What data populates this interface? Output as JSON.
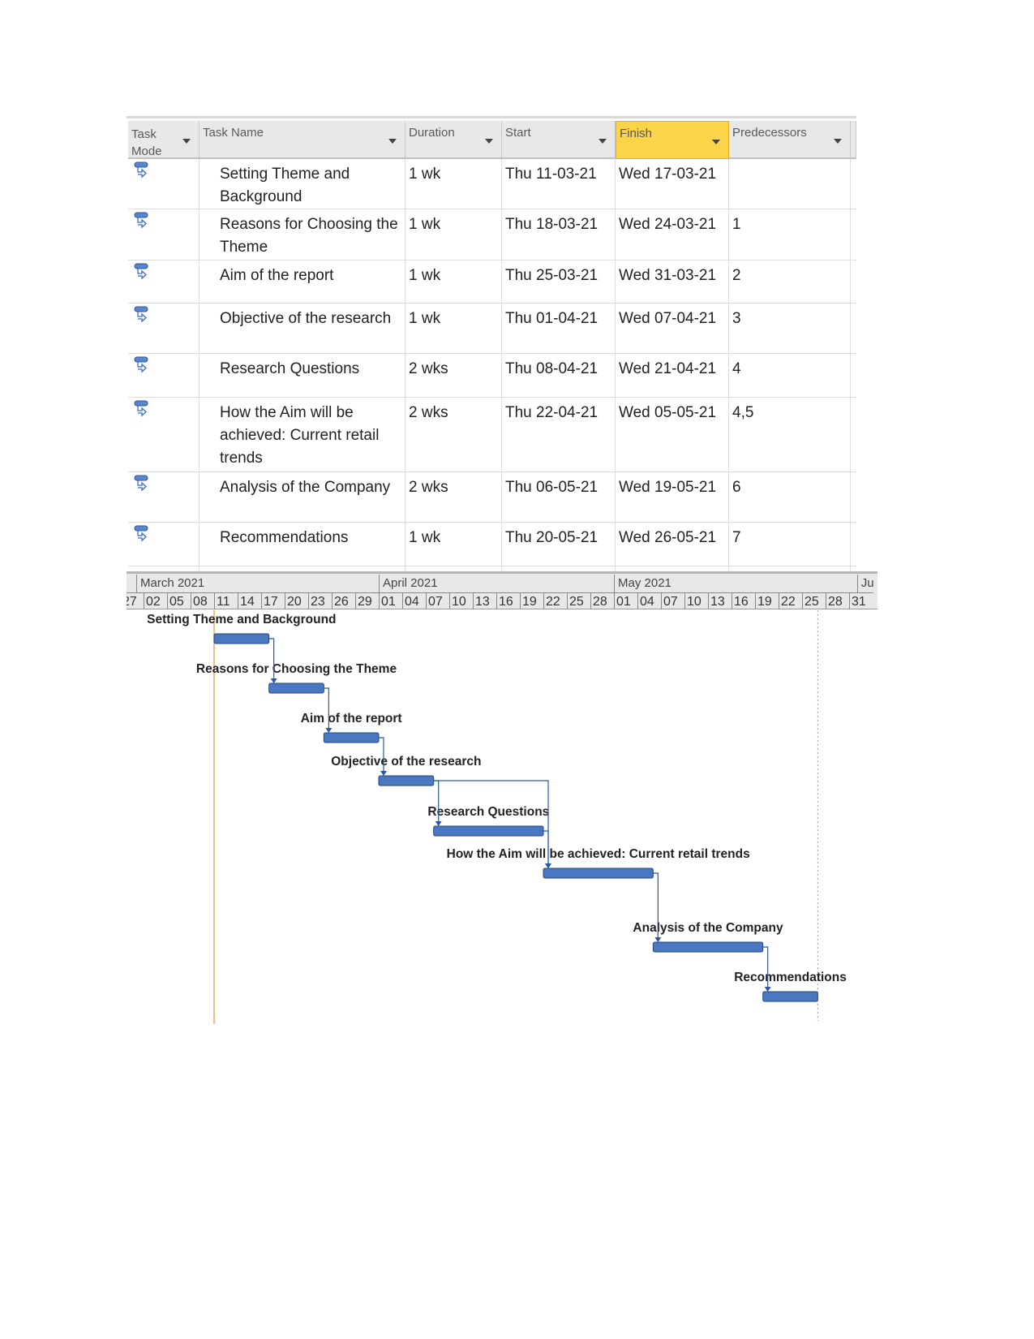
{
  "table": {
    "columns": [
      {
        "label": "Task Mode"
      },
      {
        "label": "Task Name"
      },
      {
        "label": "Duration"
      },
      {
        "label": "Start"
      },
      {
        "label": "Finish",
        "selected": true
      },
      {
        "label": "Predecessors"
      }
    ],
    "rows": [
      {
        "name": "Setting Theme and Background",
        "duration": "1 wk",
        "start": "Thu 11-03-21",
        "finish": "Wed 17-03-21",
        "predecessors": ""
      },
      {
        "name": "Reasons for Choosing the Theme",
        "duration": "1 wk",
        "start": "Thu 18-03-21",
        "finish": "Wed 24-03-21",
        "predecessors": "1"
      },
      {
        "name": "Aim of the report",
        "duration": "1 wk",
        "start": "Thu 25-03-21",
        "finish": "Wed 31-03-21",
        "predecessors": "2"
      },
      {
        "name": "Objective of the research",
        "duration": "1 wk",
        "start": "Thu 01-04-21",
        "finish": "Wed 07-04-21",
        "predecessors": "3"
      },
      {
        "name": "Research Questions",
        "duration": "2 wks",
        "start": "Thu 08-04-21",
        "finish": "Wed 21-04-21",
        "predecessors": "4"
      },
      {
        "name": "How the Aim will be achieved: Current retail trends",
        "duration": "2 wks",
        "start": "Thu 22-04-21",
        "finish": "Wed 05-05-21",
        "predecessors": "4,5"
      },
      {
        "name": "Analysis of the Company",
        "duration": "2 wks",
        "start": "Thu 06-05-21",
        "finish": "Wed 19-05-21",
        "predecessors": "6"
      },
      {
        "name": "Recommendations",
        "duration": "1 wk",
        "start": "Thu 20-05-21",
        "finish": "Wed 26-05-21",
        "predecessors": "7"
      }
    ]
  },
  "timescale": {
    "months": [
      "March 2021",
      "April 2021",
      "May 2021",
      "Ju"
    ],
    "ticks": [
      "27",
      "02",
      "05",
      "08",
      "11",
      "14",
      "17",
      "20",
      "23",
      "26",
      "29",
      "01",
      "04",
      "07",
      "10",
      "13",
      "16",
      "19",
      "22",
      "25",
      "28",
      "01",
      "04",
      "07",
      "10",
      "13",
      "16",
      "19",
      "22",
      "25",
      "28",
      "31"
    ]
  },
  "colors": {
    "bar": "#4a78c0",
    "bar_border": "#23467f",
    "link": "#2a58a8",
    "today_line": "#f0a860",
    "finish_header": "#fcd44a"
  },
  "chart_data": {
    "type": "gantt",
    "tasks": [
      {
        "id": 1,
        "label": "Setting Theme and Background",
        "start": "2021-03-11",
        "finish": "2021-03-17",
        "predecessors": []
      },
      {
        "id": 2,
        "label": "Reasons for Choosing the Theme",
        "start": "2021-03-18",
        "finish": "2021-03-24",
        "predecessors": [
          1
        ]
      },
      {
        "id": 3,
        "label": "Aim of the report",
        "start": "2021-03-25",
        "finish": "2021-03-31",
        "predecessors": [
          2
        ]
      },
      {
        "id": 4,
        "label": "Objective of the research",
        "start": "2021-04-01",
        "finish": "2021-04-07",
        "predecessors": [
          3
        ]
      },
      {
        "id": 5,
        "label": "Research Questions",
        "start": "2021-04-08",
        "finish": "2021-04-21",
        "predecessors": [
          4
        ]
      },
      {
        "id": 6,
        "label": "How the Aim will be achieved: Current retail trends",
        "start": "2021-04-22",
        "finish": "2021-05-05",
        "predecessors": [
          4,
          5
        ]
      },
      {
        "id": 7,
        "label": "Analysis of the Company",
        "start": "2021-05-06",
        "finish": "2021-05-19",
        "predecessors": [
          6
        ]
      },
      {
        "id": 8,
        "label": "Recommendations",
        "start": "2021-05-20",
        "finish": "2021-05-26",
        "predecessors": [
          7
        ]
      }
    ],
    "project_start_marker": "2021-03-11",
    "project_finish_marker": "2021-05-26"
  }
}
